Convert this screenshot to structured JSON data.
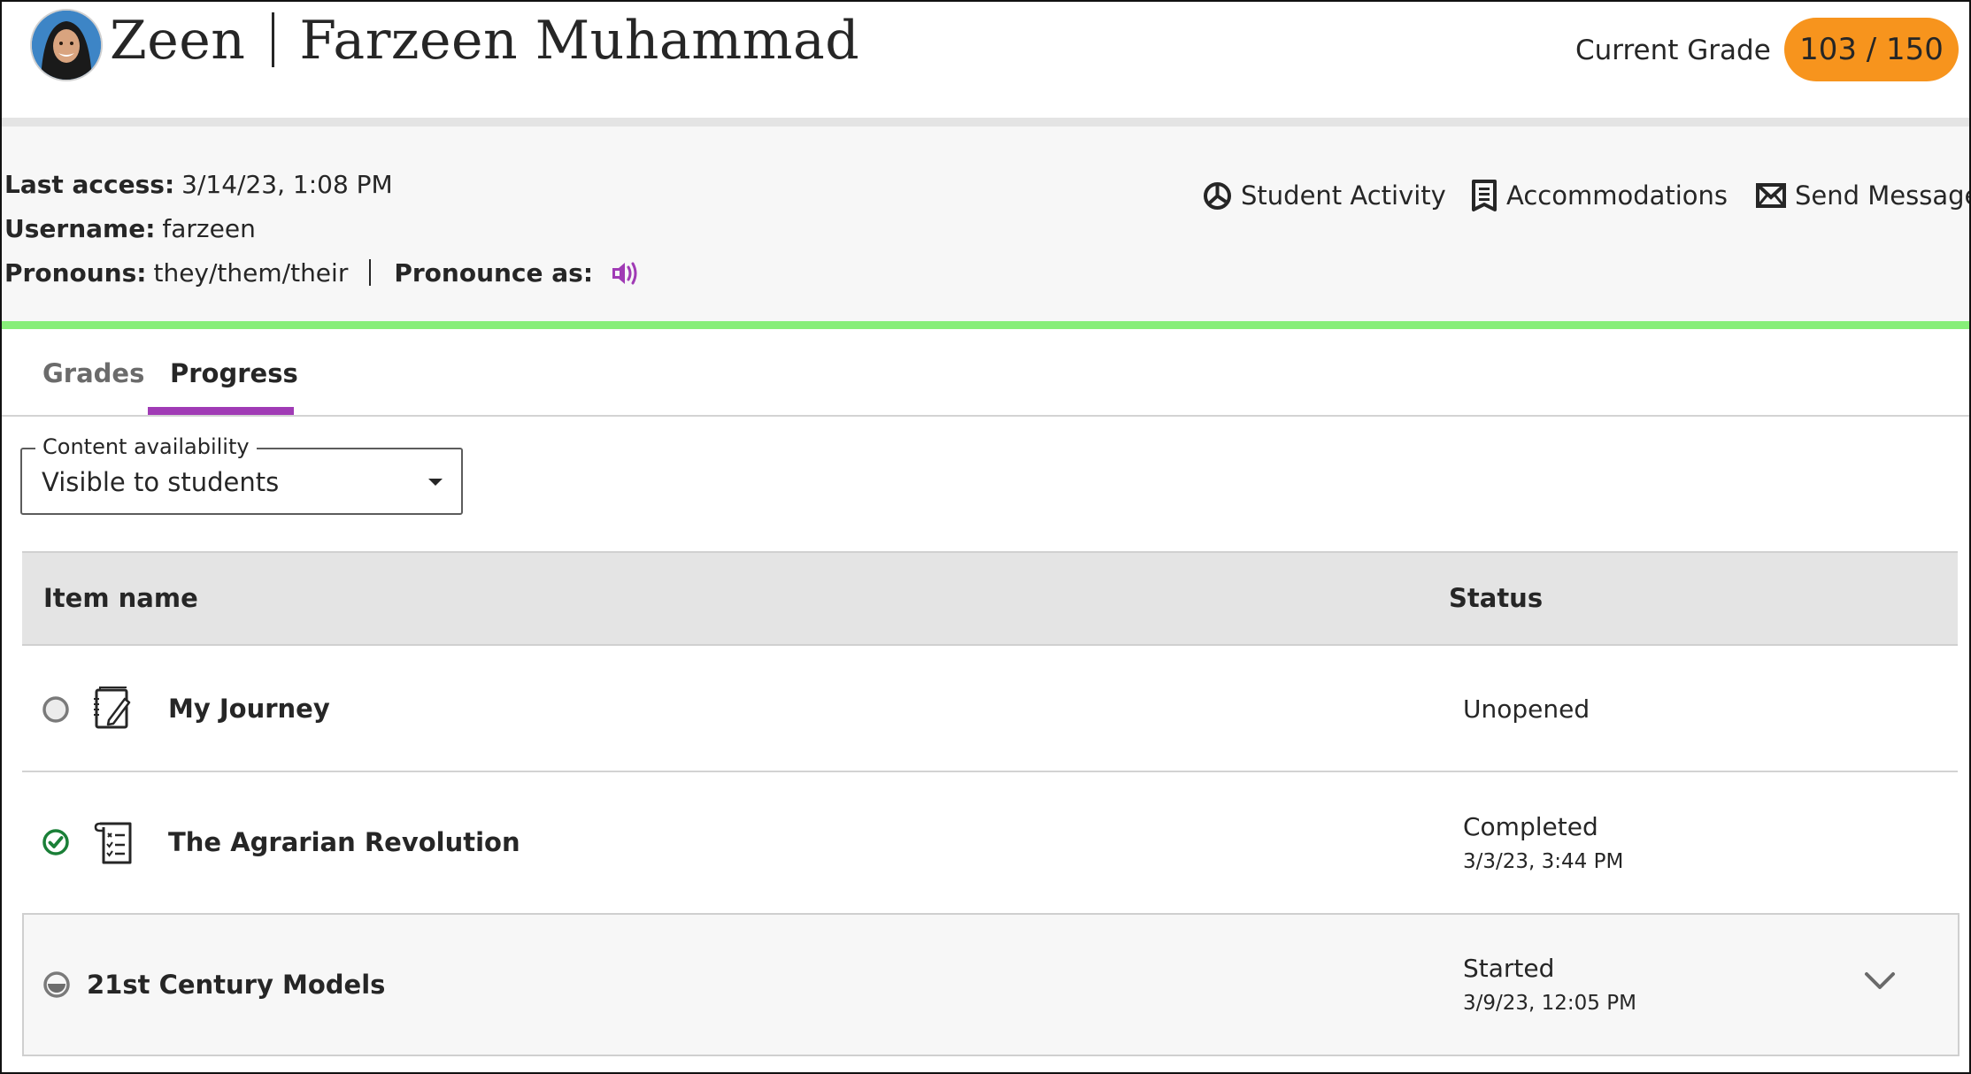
{
  "header": {
    "avatar_alt": "Student profile photo",
    "nickname": "Zeen",
    "full_name": "Farzeen Muhammad",
    "current_grade_label": "Current Grade",
    "current_grade_value": "103 / 150",
    "grade_color": "#f7941d"
  },
  "info": {
    "last_access_label": "Last access:",
    "last_access_value": "3/14/23, 1:08 PM",
    "username_label": "Username:",
    "username_value": "farzeen",
    "pronouns_label": "Pronouns:",
    "pronouns_value": "they/them/their",
    "pronounce_as_label": "Pronounce as:",
    "pronounce_icon": "speaker-icon"
  },
  "actions": [
    {
      "label": "Student Activity",
      "icon": "activity-pie-icon"
    },
    {
      "label": "Accommodations",
      "icon": "accommodations-icon"
    },
    {
      "label": "Send Message",
      "icon": "mail-icon"
    }
  ],
  "tabs": [
    {
      "label": "Grades",
      "active": false
    },
    {
      "label": "Progress",
      "active": true
    }
  ],
  "filter": {
    "legend": "Content availability",
    "selected": "Visible to students"
  },
  "table": {
    "columns": [
      "Item name",
      "Status"
    ],
    "rows": [
      {
        "status_icon": "unopened-circle-icon",
        "type_icon": "journal-icon",
        "name": "My Journey",
        "status": "Unopened",
        "date": ""
      },
      {
        "status_icon": "completed-check-icon",
        "type_icon": "assignment-checklist-icon",
        "name": "The Agrarian Revolution",
        "status": "Completed",
        "date": "3/3/23, 3:44 PM"
      },
      {
        "status_icon": "started-half-circle-icon",
        "type_icon": "",
        "name": "21st Century Models",
        "status": "Started",
        "date": "3/9/23, 12:05 PM",
        "expandable": true
      }
    ]
  },
  "colors": {
    "accent_tab": "#a03bb5",
    "info_border": "#87ee79",
    "completed": "#1a7f37",
    "speaker": "#a03bb5"
  }
}
